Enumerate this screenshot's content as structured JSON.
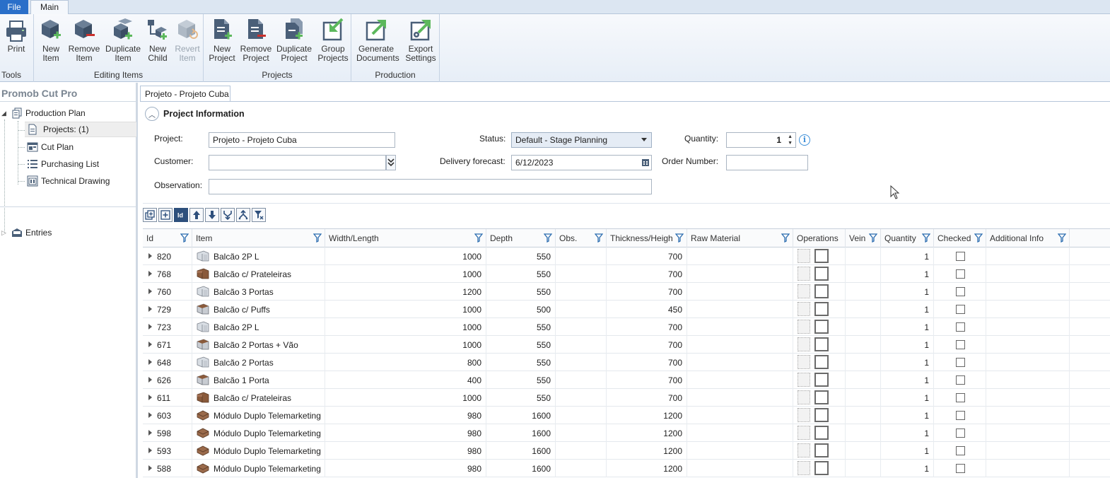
{
  "ribbon": {
    "tabs": {
      "file": "File",
      "main": "Main"
    },
    "groups": {
      "tools": {
        "label": "Tools",
        "print": "Print"
      },
      "editing": {
        "label": "Editing Items",
        "new_item": [
          "New",
          "Item"
        ],
        "remove_item": [
          "Remove",
          "Item"
        ],
        "duplicate_item": [
          "Duplicate",
          "Item"
        ],
        "new_child": [
          "New",
          "Child"
        ],
        "revert_item": [
          "Revert",
          "Item"
        ]
      },
      "projects": {
        "label": "Projects",
        "new_project": [
          "New",
          "Project"
        ],
        "remove_project": [
          "Remove",
          "Project"
        ],
        "duplicate_project": [
          "Duplicate",
          "Project"
        ],
        "group_projects": [
          "Group",
          "Projects"
        ]
      },
      "production": {
        "label": "Production",
        "generate_documents": [
          "Generate",
          "Documents"
        ],
        "export_settings": [
          "Export",
          "Settings"
        ]
      }
    }
  },
  "sidebar": {
    "title": "Promob Cut Pro",
    "tree": {
      "production_plan": "Production Plan",
      "projects": "Projects: (1)",
      "cut_plan": "Cut Plan",
      "purchasing_list": "Purchasing List",
      "technical_drawing": "Technical Drawing",
      "entries": "Entries"
    }
  },
  "doc_tab": "Projeto - Projeto Cuba",
  "project_info": {
    "title": "Project Information",
    "project_label": "Project:",
    "project_value": "Projeto - Projeto Cuba",
    "status_label": "Status:",
    "status_value": "Default - Stage Planning",
    "quantity_label": "Quantity:",
    "quantity_value": "1",
    "customer_label": "Customer:",
    "customer_value": "",
    "delivery_label": "Delivery forecast:",
    "delivery_value": "6/12/2023",
    "order_label": "Order Number:",
    "order_value": "",
    "observation_label": "Observation:",
    "observation_value": ""
  },
  "grid": {
    "columns": [
      "Id",
      "Item",
      "Width/Length",
      "Depth",
      "Obs.",
      "Thickness/Heigh",
      "Raw Material",
      "Operations",
      "Vein",
      "Quantity",
      "Checked",
      "Additional Info"
    ],
    "rows": [
      {
        "id": "820",
        "item": "Balcão 2P L",
        "width": "1000",
        "depth": "550",
        "obs": "",
        "thickness": "700",
        "raw": "",
        "vein": "",
        "qty": "1",
        "checked": false,
        "info": "",
        "thumb": "light"
      },
      {
        "id": "768",
        "item": "Balcão c/ Prateleiras",
        "width": "1000",
        "depth": "550",
        "obs": "",
        "thickness": "700",
        "raw": "",
        "vein": "",
        "qty": "1",
        "checked": false,
        "info": "",
        "thumb": "dark"
      },
      {
        "id": "760",
        "item": "Balcão 3 Portas",
        "width": "1200",
        "depth": "550",
        "obs": "",
        "thickness": "700",
        "raw": "",
        "vein": "",
        "qty": "1",
        "checked": false,
        "info": "",
        "thumb": "light"
      },
      {
        "id": "729",
        "item": "Balcão c/ Puffs",
        "width": "1000",
        "depth": "500",
        "obs": "",
        "thickness": "450",
        "raw": "",
        "vein": "",
        "qty": "1",
        "checked": false,
        "info": "",
        "thumb": "mixed"
      },
      {
        "id": "723",
        "item": "Balcão 2P L",
        "width": "1000",
        "depth": "550",
        "obs": "",
        "thickness": "700",
        "raw": "",
        "vein": "",
        "qty": "1",
        "checked": false,
        "info": "",
        "thumb": "light"
      },
      {
        "id": "671",
        "item": "Balcão 2 Portas + Vão",
        "width": "1000",
        "depth": "550",
        "obs": "",
        "thickness": "700",
        "raw": "",
        "vein": "",
        "qty": "1",
        "checked": false,
        "info": "",
        "thumb": "mixed"
      },
      {
        "id": "648",
        "item": "Balcão 2 Portas",
        "width": "800",
        "depth": "550",
        "obs": "",
        "thickness": "700",
        "raw": "",
        "vein": "",
        "qty": "1",
        "checked": false,
        "info": "",
        "thumb": "light"
      },
      {
        "id": "626",
        "item": "Balcão 1 Porta",
        "width": "400",
        "depth": "550",
        "obs": "",
        "thickness": "700",
        "raw": "",
        "vein": "",
        "qty": "1",
        "checked": false,
        "info": "",
        "thumb": "mixed"
      },
      {
        "id": "611",
        "item": "Balcão c/ Prateleiras",
        "width": "1000",
        "depth": "550",
        "obs": "",
        "thickness": "700",
        "raw": "",
        "vein": "",
        "qty": "1",
        "checked": false,
        "info": "",
        "thumb": "dark"
      },
      {
        "id": "603",
        "item": "Módulo Duplo Telemarketing",
        "width": "980",
        "depth": "1600",
        "obs": "",
        "thickness": "1200",
        "raw": "",
        "vein": "",
        "qty": "1",
        "checked": false,
        "info": "",
        "thumb": "desk"
      },
      {
        "id": "598",
        "item": "Módulo Duplo Telemarketing",
        "width": "980",
        "depth": "1600",
        "obs": "",
        "thickness": "1200",
        "raw": "",
        "vein": "",
        "qty": "1",
        "checked": false,
        "info": "",
        "thumb": "desk"
      },
      {
        "id": "593",
        "item": "Módulo Duplo Telemarketing",
        "width": "980",
        "depth": "1600",
        "obs": "",
        "thickness": "1200",
        "raw": "",
        "vein": "",
        "qty": "1",
        "checked": false,
        "info": "",
        "thumb": "desk"
      },
      {
        "id": "588",
        "item": "Módulo Duplo Telemarketing",
        "width": "980",
        "depth": "1600",
        "obs": "",
        "thickness": "1200",
        "raw": "",
        "vein": "",
        "qty": "1",
        "checked": false,
        "info": "",
        "thumb": "desk"
      }
    ]
  },
  "colors": {
    "accent": "#2a6fc9",
    "icon_dark": "#4a5f78",
    "icon_green": "#5cb85c",
    "icon_red": "#c9302c",
    "filter_blue": "#2b6cb0"
  }
}
